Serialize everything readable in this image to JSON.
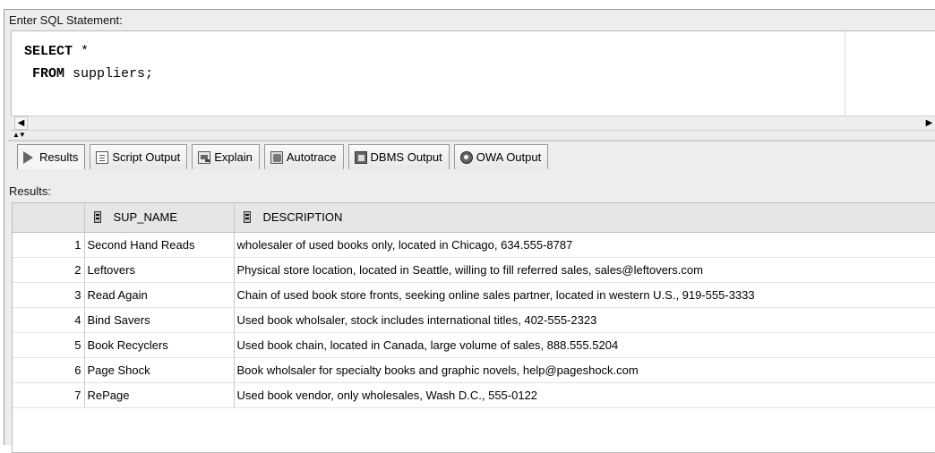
{
  "editor": {
    "label": "Enter SQL Statement:",
    "line1_keyword": "SELECT",
    "line1_rest": " *",
    "line2_keyword": "FROM",
    "line2_rest": " suppliers;"
  },
  "tabs": [
    {
      "label": "Results",
      "icon": "play-icon"
    },
    {
      "label": "Script Output",
      "icon": "script-output-icon"
    },
    {
      "label": "Explain",
      "icon": "explain-icon"
    },
    {
      "label": "Autotrace",
      "icon": "autotrace-icon"
    },
    {
      "label": "DBMS Output",
      "icon": "dbms-output-icon"
    },
    {
      "label": "OWA Output",
      "icon": "owa-output-icon"
    }
  ],
  "results": {
    "label": "Results:",
    "columns": [
      "SUP_NAME",
      "DESCRIPTION"
    ],
    "rows": [
      {
        "row": "1",
        "sup_name": "Second Hand Reads",
        "description": "wholesaler of used books only, located in Chicago, 634.555-8787"
      },
      {
        "row": "2",
        "sup_name": "Leftovers",
        "description": "Physical store location, located in Seattle, willing to fill referred sales, sales@leftovers.com"
      },
      {
        "row": "3",
        "sup_name": "Read Again",
        "description": "Chain of used book store fronts, seeking online sales partner, located in western U.S., 919-555-3333"
      },
      {
        "row": "4",
        "sup_name": "Bind Savers",
        "description": "Used book wholsaler, stock includes international titles, 402-555-2323"
      },
      {
        "row": "5",
        "sup_name": "Book Recyclers",
        "description": "Used book chain, located in Canada, large volume of sales, 888.555.5204"
      },
      {
        "row": "6",
        "sup_name": "Page Shock",
        "description": "Book wholsaler for specialty books and graphic novels, help@pageshock.com"
      },
      {
        "row": "7",
        "sup_name": "RePage",
        "description": "Used book vendor, only wholesales, Wash D.C., 555-0122"
      }
    ]
  }
}
